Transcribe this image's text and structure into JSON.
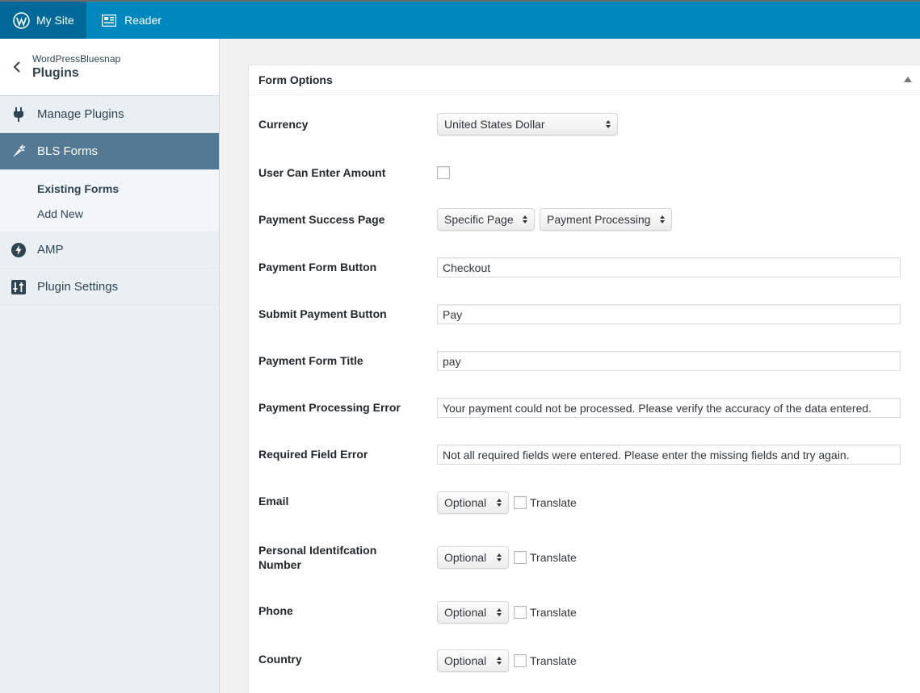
{
  "masterbar": {
    "my_site_label": "My Site",
    "reader_label": "Reader",
    "color": "#0087be"
  },
  "sidebar": {
    "site_name": "WordPressBluesnap",
    "section": "Plugins",
    "items": [
      {
        "label": "Manage Plugins",
        "icon": "plug-icon"
      },
      {
        "label": "BLS Forms",
        "icon": "carrot-icon"
      },
      {
        "label": "AMP",
        "icon": "amp-bolt-icon"
      },
      {
        "label": "Plugin Settings",
        "icon": "sliders-icon"
      }
    ],
    "sub_items": [
      "Existing Forms",
      "Add New"
    ],
    "selected_color": "#537994"
  },
  "form_options": {
    "title": "Form Options",
    "currency": {
      "label": "Currency",
      "value": "United States Dollar"
    },
    "user_can_enter_amount": {
      "label": "User Can Enter Amount",
      "checked": false
    },
    "payment_success_page": {
      "label": "Payment Success Page",
      "type_value": "Specific Page",
      "page_value": "Payment Processing"
    },
    "payment_form_button": {
      "label": "Payment Form Button",
      "value": "Checkout"
    },
    "submit_payment_button": {
      "label": "Submit Payment Button",
      "value": "Pay"
    },
    "payment_form_title": {
      "label": "Payment Form Title",
      "value": "pay"
    },
    "payment_processing_error": {
      "label": "Payment Processing Error",
      "value": "Your payment could not be processed. Please verify the accuracy of the data entered."
    },
    "required_field_error": {
      "label": "Required Field Error",
      "value": "Not all required fields were entered. Please enter the missing fields and try again."
    },
    "translate_label": "Translate",
    "fields": [
      {
        "label": "Email",
        "value": "Optional"
      },
      {
        "label": "Personal Identifcation Number",
        "value": "Optional"
      },
      {
        "label": "Phone",
        "value": "Optional"
      },
      {
        "label": "Country",
        "value": "Optional"
      }
    ]
  }
}
